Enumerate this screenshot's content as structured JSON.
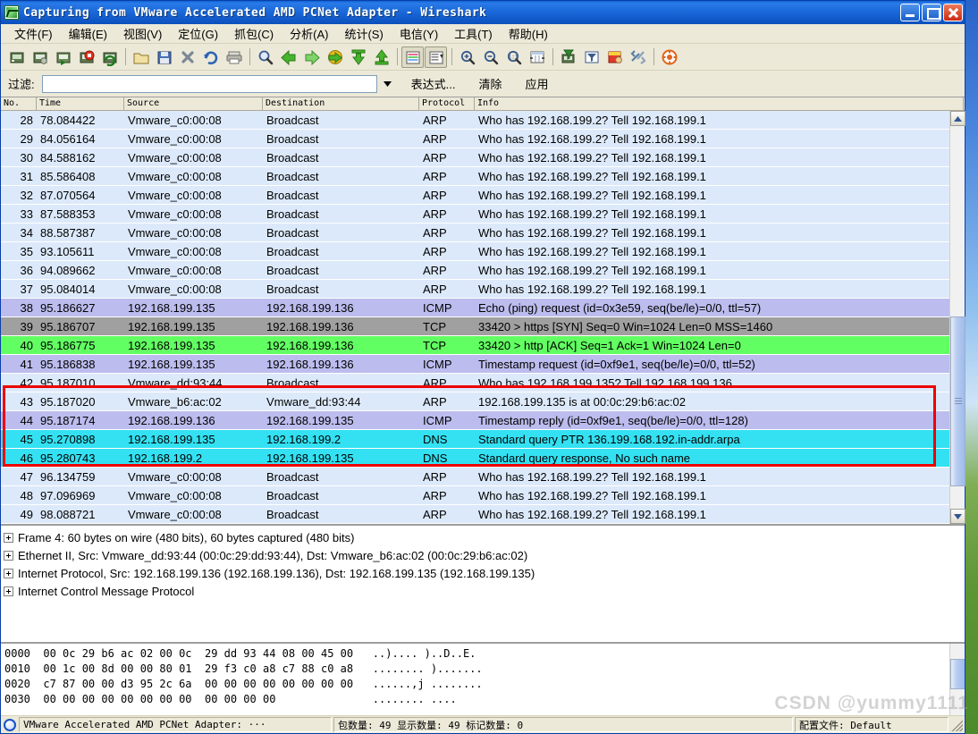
{
  "window": {
    "title": "Capturing from VMware Accelerated AMD PCNet Adapter - Wireshark",
    "icon": "wireshark-icon",
    "minimize_label": "–",
    "maximize_label": "□",
    "close_label": "×"
  },
  "menu": {
    "items": [
      {
        "label": "文件(F)",
        "name": "menu-file"
      },
      {
        "label": "编辑(E)",
        "name": "menu-edit"
      },
      {
        "label": "视图(V)",
        "name": "menu-view"
      },
      {
        "label": "定位(G)",
        "name": "menu-go"
      },
      {
        "label": "抓包(C)",
        "name": "menu-capture"
      },
      {
        "label": "分析(A)",
        "name": "menu-analyze"
      },
      {
        "label": "统计(S)",
        "name": "menu-statistics"
      },
      {
        "label": "电信(Y)",
        "name": "menu-telephony"
      },
      {
        "label": "工具(T)",
        "name": "menu-tools"
      },
      {
        "label": "帮助(H)",
        "name": "menu-help"
      }
    ]
  },
  "toolbar": {
    "buttons": [
      "interfaces-icon",
      "capture-options-icon",
      "start-capture-icon",
      "stop-capture-icon",
      "restart-capture-icon",
      "sep",
      "open-file-icon",
      "save-file-icon",
      "close-file-icon",
      "reload-icon",
      "print-icon",
      "sep",
      "find-packet-icon",
      "go-back-icon",
      "go-forward-icon",
      "go-to-packet-icon",
      "go-first-packet-icon",
      "go-last-packet-icon",
      "sep",
      "colorize-icon",
      "auto-scroll-icon",
      "sep",
      "zoom-in-icon",
      "zoom-out-icon",
      "zoom-reset-icon",
      "resize-columns-icon",
      "sep",
      "capture-filters-icon",
      "display-filters-icon",
      "coloring-rules-icon",
      "preferences-icon",
      "sep",
      "help-icon"
    ]
  },
  "filter": {
    "label": "过滤:",
    "value": "",
    "placeholder": "",
    "dropdown_icon": "chevron-down-icon",
    "expression_button": "表达式...",
    "clear_button": "清除",
    "apply_button": "应用"
  },
  "packet_list": {
    "columns": [
      "No.",
      "Time",
      "Source",
      "Destination",
      "Protocol",
      "Info"
    ],
    "rows": [
      {
        "no": "28",
        "time": "78.084422",
        "src": "Vmware_c0:00:08",
        "dst": "Broadcast",
        "proto": "ARP",
        "info": "Who has 192.168.199.2?  Tell 192.168.199.1",
        "bg": "#dce9fa"
      },
      {
        "no": "29",
        "time": "84.056164",
        "src": "Vmware_c0:00:08",
        "dst": "Broadcast",
        "proto": "ARP",
        "info": "Who has 192.168.199.2?  Tell 192.168.199.1",
        "bg": "#dce9fa"
      },
      {
        "no": "30",
        "time": "84.588162",
        "src": "Vmware_c0:00:08",
        "dst": "Broadcast",
        "proto": "ARP",
        "info": "Who has 192.168.199.2?  Tell 192.168.199.1",
        "bg": "#dce9fa"
      },
      {
        "no": "31",
        "time": "85.586408",
        "src": "Vmware_c0:00:08",
        "dst": "Broadcast",
        "proto": "ARP",
        "info": "Who has 192.168.199.2?  Tell 192.168.199.1",
        "bg": "#dce9fa"
      },
      {
        "no": "32",
        "time": "87.070564",
        "src": "Vmware_c0:00:08",
        "dst": "Broadcast",
        "proto": "ARP",
        "info": "Who has 192.168.199.2?  Tell 192.168.199.1",
        "bg": "#dce9fa"
      },
      {
        "no": "33",
        "time": "87.588353",
        "src": "Vmware_c0:00:08",
        "dst": "Broadcast",
        "proto": "ARP",
        "info": "Who has 192.168.199.2?  Tell 192.168.199.1",
        "bg": "#dce9fa"
      },
      {
        "no": "34",
        "time": "88.587387",
        "src": "Vmware_c0:00:08",
        "dst": "Broadcast",
        "proto": "ARP",
        "info": "Who has 192.168.199.2?  Tell 192.168.199.1",
        "bg": "#dce9fa"
      },
      {
        "no": "35",
        "time": "93.105611",
        "src": "Vmware_c0:00:08",
        "dst": "Broadcast",
        "proto": "ARP",
        "info": "Who has 192.168.199.2?  Tell 192.168.199.1",
        "bg": "#dce9fa"
      },
      {
        "no": "36",
        "time": "94.089662",
        "src": "Vmware_c0:00:08",
        "dst": "Broadcast",
        "proto": "ARP",
        "info": "Who has 192.168.199.2?  Tell 192.168.199.1",
        "bg": "#dce9fa"
      },
      {
        "no": "37",
        "time": "95.084014",
        "src": "Vmware_c0:00:08",
        "dst": "Broadcast",
        "proto": "ARP",
        "info": "Who has 192.168.199.2?  Tell 192.168.199.1",
        "bg": "#dce9fa"
      },
      {
        "no": "38",
        "time": "95.186627",
        "src": "192.168.199.135",
        "dst": "192.168.199.136",
        "proto": "ICMP",
        "info": "Echo (ping) request  (id=0x3e59, seq(be/le)=0/0, ttl=57)",
        "bg": "#bcbcee"
      },
      {
        "no": "39",
        "time": "95.186707",
        "src": "192.168.199.135",
        "dst": "192.168.199.136",
        "proto": "TCP",
        "info": "33420 > https [SYN] Seq=0 Win=1024 Len=0 MSS=1460",
        "bg": "#a0a0a0"
      },
      {
        "no": "40",
        "time": "95.186775",
        "src": "192.168.199.135",
        "dst": "192.168.199.136",
        "proto": "TCP",
        "info": "33420 > http [ACK] Seq=1 Ack=1 Win=1024 Len=0",
        "bg": "#62ff62"
      },
      {
        "no": "41",
        "time": "95.186838",
        "src": "192.168.199.135",
        "dst": "192.168.199.136",
        "proto": "ICMP",
        "info": "Timestamp request    (id=0xf9e1, seq(be/le)=0/0, ttl=52)",
        "bg": "#bcbcee"
      },
      {
        "no": "42",
        "time": "95.187010",
        "src": "Vmware_dd:93:44",
        "dst": "Broadcast",
        "proto": "ARP",
        "info": "Who has 192.168.199.135?  Tell 192.168.199.136",
        "bg": "#dce9fa"
      },
      {
        "no": "43",
        "time": "95.187020",
        "src": "Vmware_b6:ac:02",
        "dst": "Vmware_dd:93:44",
        "proto": "ARP",
        "info": "192.168.199.135 is at 00:0c:29:b6:ac:02",
        "bg": "#dce9fa"
      },
      {
        "no": "44",
        "time": "95.187174",
        "src": "192.168.199.136",
        "dst": "192.168.199.135",
        "proto": "ICMP",
        "info": "Timestamp reply      (id=0xf9e1, seq(be/le)=0/0, ttl=128)",
        "bg": "#bcbcee"
      },
      {
        "no": "45",
        "time": "95.270898",
        "src": "192.168.199.135",
        "dst": "192.168.199.2",
        "proto": "DNS",
        "info": "Standard query PTR 136.199.168.192.in-addr.arpa",
        "bg": "#33e1f2"
      },
      {
        "no": "46",
        "time": "95.280743",
        "src": "192.168.199.2",
        "dst": "192.168.199.135",
        "proto": "DNS",
        "info": "Standard query response, No such name",
        "bg": "#33e1f2"
      },
      {
        "no": "47",
        "time": "96.134759",
        "src": "Vmware_c0:00:08",
        "dst": "Broadcast",
        "proto": "ARP",
        "info": "Who has 192.168.199.2?  Tell 192.168.199.1",
        "bg": "#dce9fa"
      },
      {
        "no": "48",
        "time": "97.096969",
        "src": "Vmware_c0:00:08",
        "dst": "Broadcast",
        "proto": "ARP",
        "info": "Who has 192.168.199.2?  Tell 192.168.199.1",
        "bg": "#dce9fa"
      },
      {
        "no": "49",
        "time": "98.088721",
        "src": "Vmware_c0:00:08",
        "dst": "Broadcast",
        "proto": "ARP",
        "info": "Who has 192.168.199.2?  Tell 192.168.199.1",
        "bg": "#dce9fa"
      }
    ],
    "annotation_highlight_color": "#ee0000",
    "scrollbar": {
      "up_icon": "chevron-up-icon",
      "down_icon": "chevron-down-icon"
    }
  },
  "packet_details": {
    "rows": [
      "Frame 4: 60 bytes on wire (480 bits), 60 bytes captured (480 bits)",
      "Ethernet II, Src: Vmware_dd:93:44 (00:0c:29:dd:93:44), Dst: Vmware_b6:ac:02 (00:0c:29:b6:ac:02)",
      "Internet Protocol, Src: 192.168.199.136 (192.168.199.136), Dst: 192.168.199.135 (192.168.199.135)",
      "Internet Control Message Protocol"
    ]
  },
  "packet_bytes": {
    "rows": [
      {
        "offset": "0000",
        "hex1": "00 0c 29 b6 ac 02 00 0c",
        "hex2": "29 dd 93 44 08 00 45 00",
        "ascii": "..).... )..D..E."
      },
      {
        "offset": "0010",
        "hex1": "00 1c 00 8d 00 00 80 01",
        "hex2": "29 f3 c0 a8 c7 88 c0 a8",
        "ascii": "........ )......."
      },
      {
        "offset": "0020",
        "hex1": "c7 87 00 00 d3 95 2c 6a",
        "hex2": "00 00 00 00 00 00 00 00",
        "ascii": "......,j ........"
      },
      {
        "offset": "0030",
        "hex1": "00 00 00 00 00 00 00 00",
        "hex2": "00 00 00 00",
        "ascii": "........ ...."
      }
    ]
  },
  "status_bar": {
    "icon": "capture-status-icon",
    "interface": "VMware Accelerated AMD PCNet Adapter: ···",
    "counts": "包数量: 49 显示数量: 49 标记数量: 0",
    "profile": "配置文件: Default"
  },
  "watermark": {
    "text": "CSDN @yummy1111"
  }
}
